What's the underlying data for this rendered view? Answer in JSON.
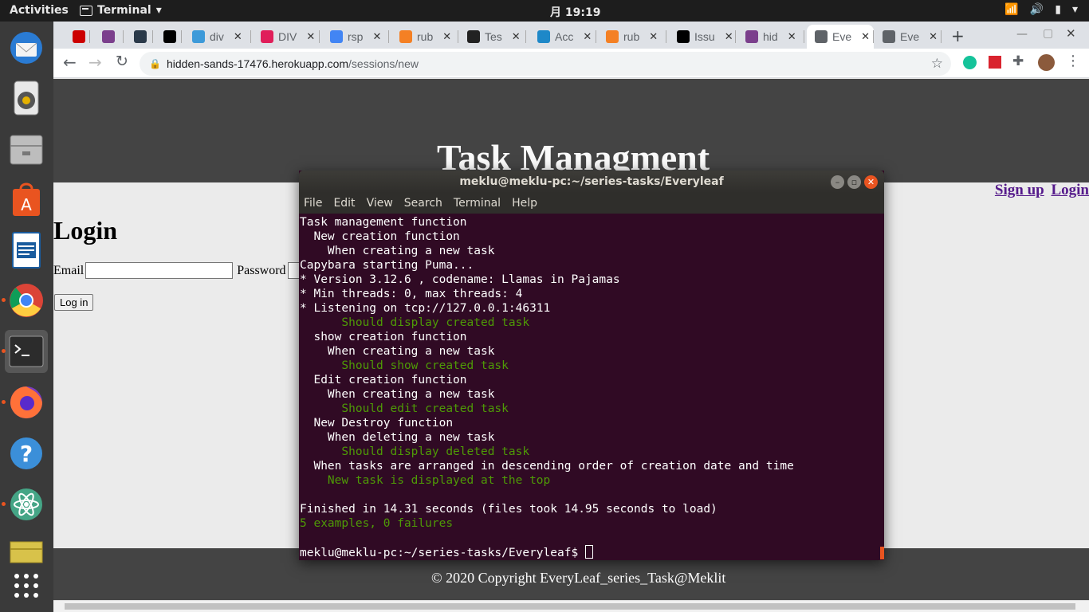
{
  "topbar": {
    "activities": "Activities",
    "app_name": "Terminal",
    "clock": "月 19:19"
  },
  "dock": {
    "items": [
      {
        "name": "thunderbird-icon"
      },
      {
        "name": "rhythmbox-icon"
      },
      {
        "name": "files-icon"
      },
      {
        "name": "software-center-icon"
      },
      {
        "name": "writer-icon"
      },
      {
        "name": "chrome-icon"
      },
      {
        "name": "terminal-icon"
      },
      {
        "name": "firefox-icon"
      },
      {
        "name": "help-icon"
      },
      {
        "name": "atom-icon"
      },
      {
        "name": "notes-icon"
      },
      {
        "name": "app-grid-icon"
      }
    ]
  },
  "browser": {
    "tabs": [
      {
        "label": "",
        "favicon_color": "#cc0000"
      },
      {
        "label": "",
        "favicon_color": "#7b3f8c"
      },
      {
        "label": "",
        "favicon_color": "#2b3a4a"
      },
      {
        "label": "",
        "favicon_color": "#000000"
      },
      {
        "label": "div",
        "favicon_color": "#3d9ad9"
      },
      {
        "label": "DIV",
        "favicon_color": "#e01e5a"
      },
      {
        "label": "rsp",
        "favicon_color": "#4285f4"
      },
      {
        "label": "rub",
        "favicon_color": "#f48024"
      },
      {
        "label": "Tes",
        "favicon_color": "#222222"
      },
      {
        "label": "Acc",
        "favicon_color": "#1e88c8"
      },
      {
        "label": "rub",
        "favicon_color": "#f48024"
      },
      {
        "label": "Issu",
        "favicon_color": "#000000"
      },
      {
        "label": "hid",
        "favicon_color": "#7b3f8c"
      },
      {
        "label": "Eve",
        "favicon_color": "#5f6368"
      },
      {
        "label": "Eve",
        "favicon_color": "#5f6368"
      }
    ],
    "active_tab_index": 13,
    "url_host": "hidden-sands-17476.herokuapp.com",
    "url_path": "/sessions/new"
  },
  "site": {
    "title": "Task Managment",
    "nav": {
      "signup": "Sign up",
      "login": "Login"
    },
    "login_heading": "Login",
    "email_label": "Email",
    "email_value": "",
    "password_label": "Password",
    "login_button": "Log in",
    "footer": "© 2020 Copyright EveryLeaf_series_Task@Meklit"
  },
  "terminal": {
    "title": "meklu@meklu-pc:~/series-tasks/Everyleaf",
    "menu": [
      "File",
      "Edit",
      "View",
      "Search",
      "Terminal",
      "Help"
    ],
    "lines": [
      {
        "text": "Task management function",
        "color": "white"
      },
      {
        "text": "  New creation function",
        "color": "white"
      },
      {
        "text": "    When creating a new task",
        "color": "white"
      },
      {
        "text": "Capybara starting Puma...",
        "color": "white"
      },
      {
        "text": "* Version 3.12.6 , codename: Llamas in Pajamas",
        "color": "white"
      },
      {
        "text": "* Min threads: 0, max threads: 4",
        "color": "white"
      },
      {
        "text": "* Listening on tcp://127.0.0.1:46311",
        "color": "white"
      },
      {
        "text": "      Should display created task",
        "color": "green"
      },
      {
        "text": "  show creation function",
        "color": "white"
      },
      {
        "text": "    When creating a new task",
        "color": "white"
      },
      {
        "text": "      Should show created task",
        "color": "green"
      },
      {
        "text": "  Edit creation function",
        "color": "white"
      },
      {
        "text": "    When creating a new task",
        "color": "white"
      },
      {
        "text": "      Should edit created task",
        "color": "green"
      },
      {
        "text": "  New Destroy function",
        "color": "white"
      },
      {
        "text": "    When deleting a new task",
        "color": "white"
      },
      {
        "text": "      Should display deleted task",
        "color": "green"
      },
      {
        "text": "  When tasks are arranged in descending order of creation date and time",
        "color": "white"
      },
      {
        "text": "    New task is displayed at the top",
        "color": "green"
      },
      {
        "text": "",
        "color": "white"
      },
      {
        "text": "Finished in 14.31 seconds (files took 14.95 seconds to load)",
        "color": "white"
      },
      {
        "text": "5 examples, 0 failures",
        "color": "green"
      },
      {
        "text": "",
        "color": "white"
      }
    ],
    "prompt": "meklu@meklu-pc:~/series-tasks/Everyleaf$ "
  }
}
